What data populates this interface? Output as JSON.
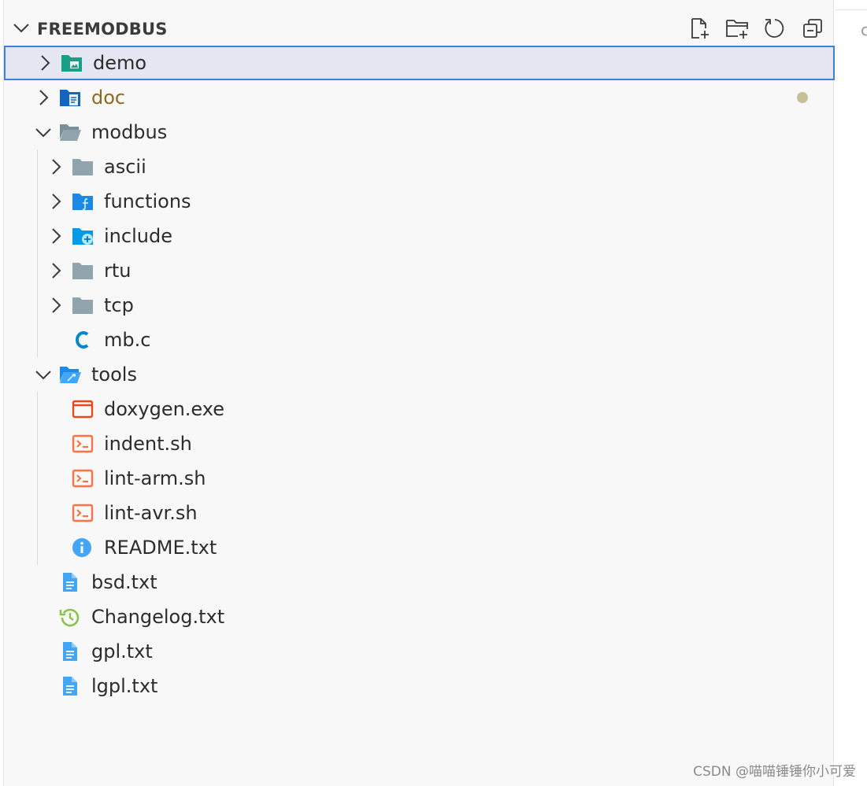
{
  "explorer": {
    "title": "FREEMODBUS",
    "actions": [
      "new-file",
      "new-folder",
      "refresh",
      "collapse-all"
    ]
  },
  "tree": {
    "demo": "demo",
    "doc": "doc",
    "modbus": "modbus",
    "ascii": "ascii",
    "functions": "functions",
    "include": "include",
    "rtu": "rtu",
    "tcp": "tcp",
    "mb_c": "mb.c",
    "tools": "tools",
    "doxygen": "doxygen.exe",
    "indent": "indent.sh",
    "lint_arm": "lint-arm.sh",
    "lint_avr": "lint-avr.sh",
    "readme": "README.txt",
    "bsd": "bsd.txt",
    "changelog": "Changelog.txt",
    "gpl": "gpl.txt",
    "lgpl": "lgpl.txt"
  },
  "colors": {
    "selection_border": "#3d7fe0",
    "selection_bg": "#e4e6f1",
    "modified_text": "#8d6b1c",
    "modified_dot": "#c7bf98"
  },
  "watermark": "CSDN @喵喵锤锤你小可爱"
}
